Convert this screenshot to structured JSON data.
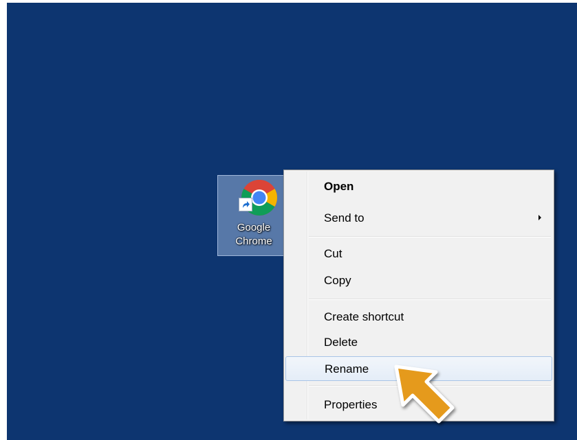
{
  "desktop_icon": {
    "label_line1": "Google",
    "label_line2": "Chrome",
    "icon": "chrome-icon",
    "badge": "shortcut-arrow-icon"
  },
  "context_menu": {
    "items": [
      {
        "label": "Open",
        "bold": true
      },
      {
        "label": "Send to",
        "submenu": true
      },
      {
        "label": "Cut"
      },
      {
        "label": "Copy"
      },
      {
        "label": "Create shortcut"
      },
      {
        "label": "Delete"
      },
      {
        "label": "Rename",
        "highlighted": true
      },
      {
        "label": "Properties"
      }
    ]
  },
  "colors": {
    "desktop_bg": "#0d3570",
    "menu_bg": "#f1f1f1",
    "highlight_border": "#a8c4e7",
    "pointer_fill": "#e59a1a"
  },
  "annotation": {
    "icon": "pointer-arrow-icon"
  }
}
